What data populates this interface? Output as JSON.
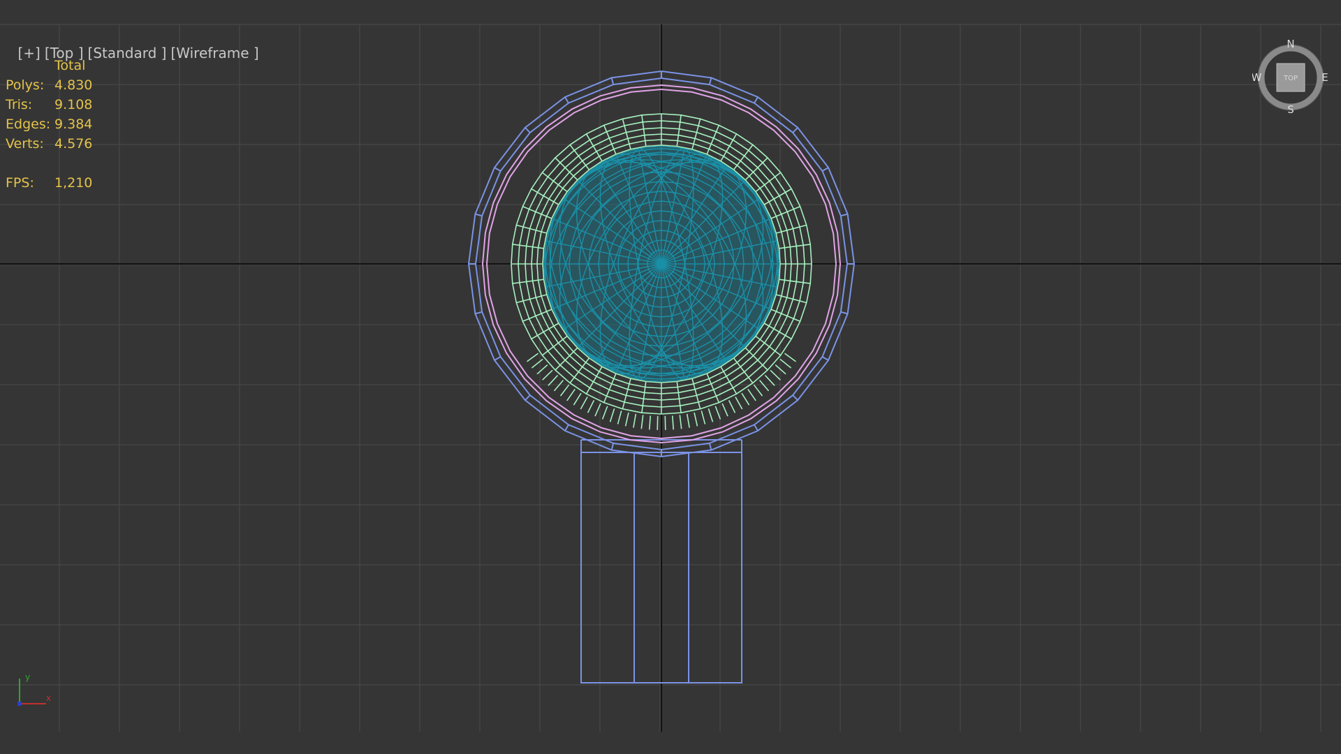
{
  "viewport": {
    "labels": [
      "[+]",
      "[Top ]",
      "[Standard ]",
      "[Wireframe ]"
    ]
  },
  "stats": {
    "header": "Total",
    "rows": [
      {
        "key": "Polys:",
        "value": "4.830"
      },
      {
        "key": "Tris:",
        "value": "9.108"
      },
      {
        "key": "Edges:",
        "value": "9.384"
      },
      {
        "key": "Verts:",
        "value": "4.576"
      }
    ],
    "fps_key": "FPS:",
    "fps_value": "1,210"
  },
  "viewcube": {
    "face": "TOP",
    "north": "N",
    "south": "S",
    "east": "E",
    "west": "W"
  },
  "axis": {
    "x": "x",
    "y": "y"
  },
  "colors": {
    "background": "#353535",
    "grid": "#4a4a4a",
    "axis_line": "#111111",
    "outer_shell": "#7b93e6",
    "pink_ring": "#e0a3e6",
    "green_ring": "#a6f2c0",
    "inner_sphere": "#1a90a8",
    "stats_text": "#e5c34a",
    "label_text": "#c8c8c8"
  }
}
